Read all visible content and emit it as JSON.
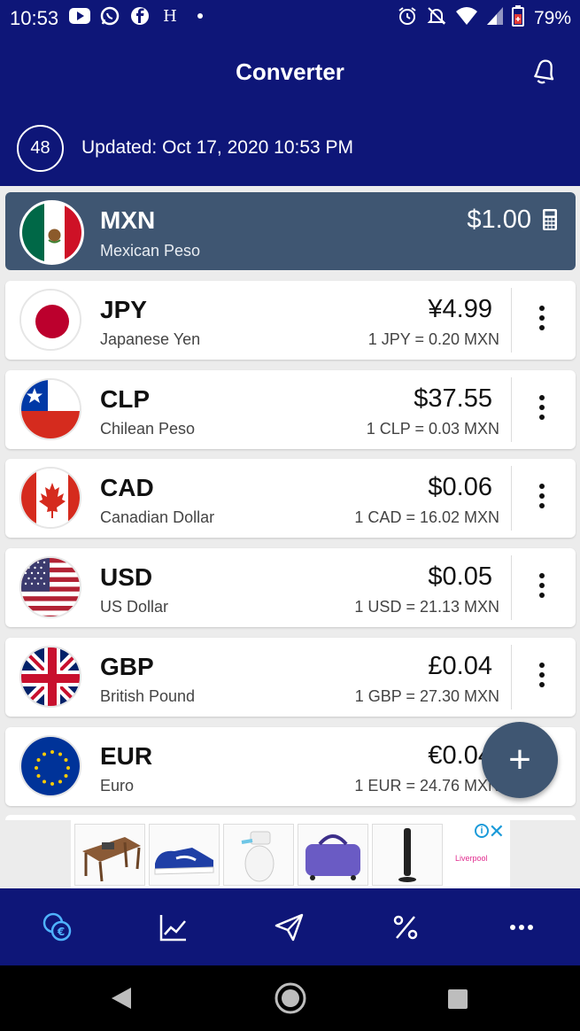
{
  "status_bar": {
    "time": "10:53",
    "battery": "79%",
    "left_icons": [
      "youtube-icon",
      "whatsapp-icon",
      "facebook-icon",
      "hotel-h-icon",
      "dot-icon"
    ],
    "right_icons": [
      "alarm-icon",
      "notifications-off-icon",
      "wifi-icon",
      "signal-icon",
      "battery-icon"
    ],
    "h_glyph": "H"
  },
  "header": {
    "title": "Converter",
    "refresh_counter": "48",
    "updated_text": "Updated: Oct 17, 2020 10:53 PM"
  },
  "base_currency": {
    "code": "MXN",
    "name": "Mexican Peso",
    "amount": "$1.00"
  },
  "currencies": [
    {
      "code": "JPY",
      "name": "Japanese Yen",
      "amount": "¥4.99",
      "rate": "1 JPY = 0.20 MXN"
    },
    {
      "code": "CLP",
      "name": "Chilean Peso",
      "amount": "$37.55",
      "rate": "1 CLP = 0.03 MXN"
    },
    {
      "code": "CAD",
      "name": "Canadian Dollar",
      "amount": "$0.06",
      "rate": "1 CAD = 16.02 MXN"
    },
    {
      "code": "USD",
      "name": "US Dollar",
      "amount": "$0.05",
      "rate": "1 USD = 21.13 MXN"
    },
    {
      "code": "GBP",
      "name": "British Pound",
      "amount": "£0.04",
      "rate": "1 GBP = 27.30 MXN"
    },
    {
      "code": "EUR",
      "name": "Euro",
      "amount": "€0.04",
      "rate": "1 EUR = 24.76 MXN"
    }
  ],
  "fab": {
    "symbol": "+"
  },
  "ad": {
    "brand": "Liverpool",
    "info_symbol": "i",
    "close_symbol": "✕"
  },
  "bottom_nav": [
    "converter-icon",
    "chart-icon",
    "send-icon",
    "percent-icon",
    "more-icon"
  ],
  "colors": {
    "header_bg": "#0e1678",
    "base_card_bg": "#3f5672",
    "active_nav": "#4fb3ff"
  }
}
